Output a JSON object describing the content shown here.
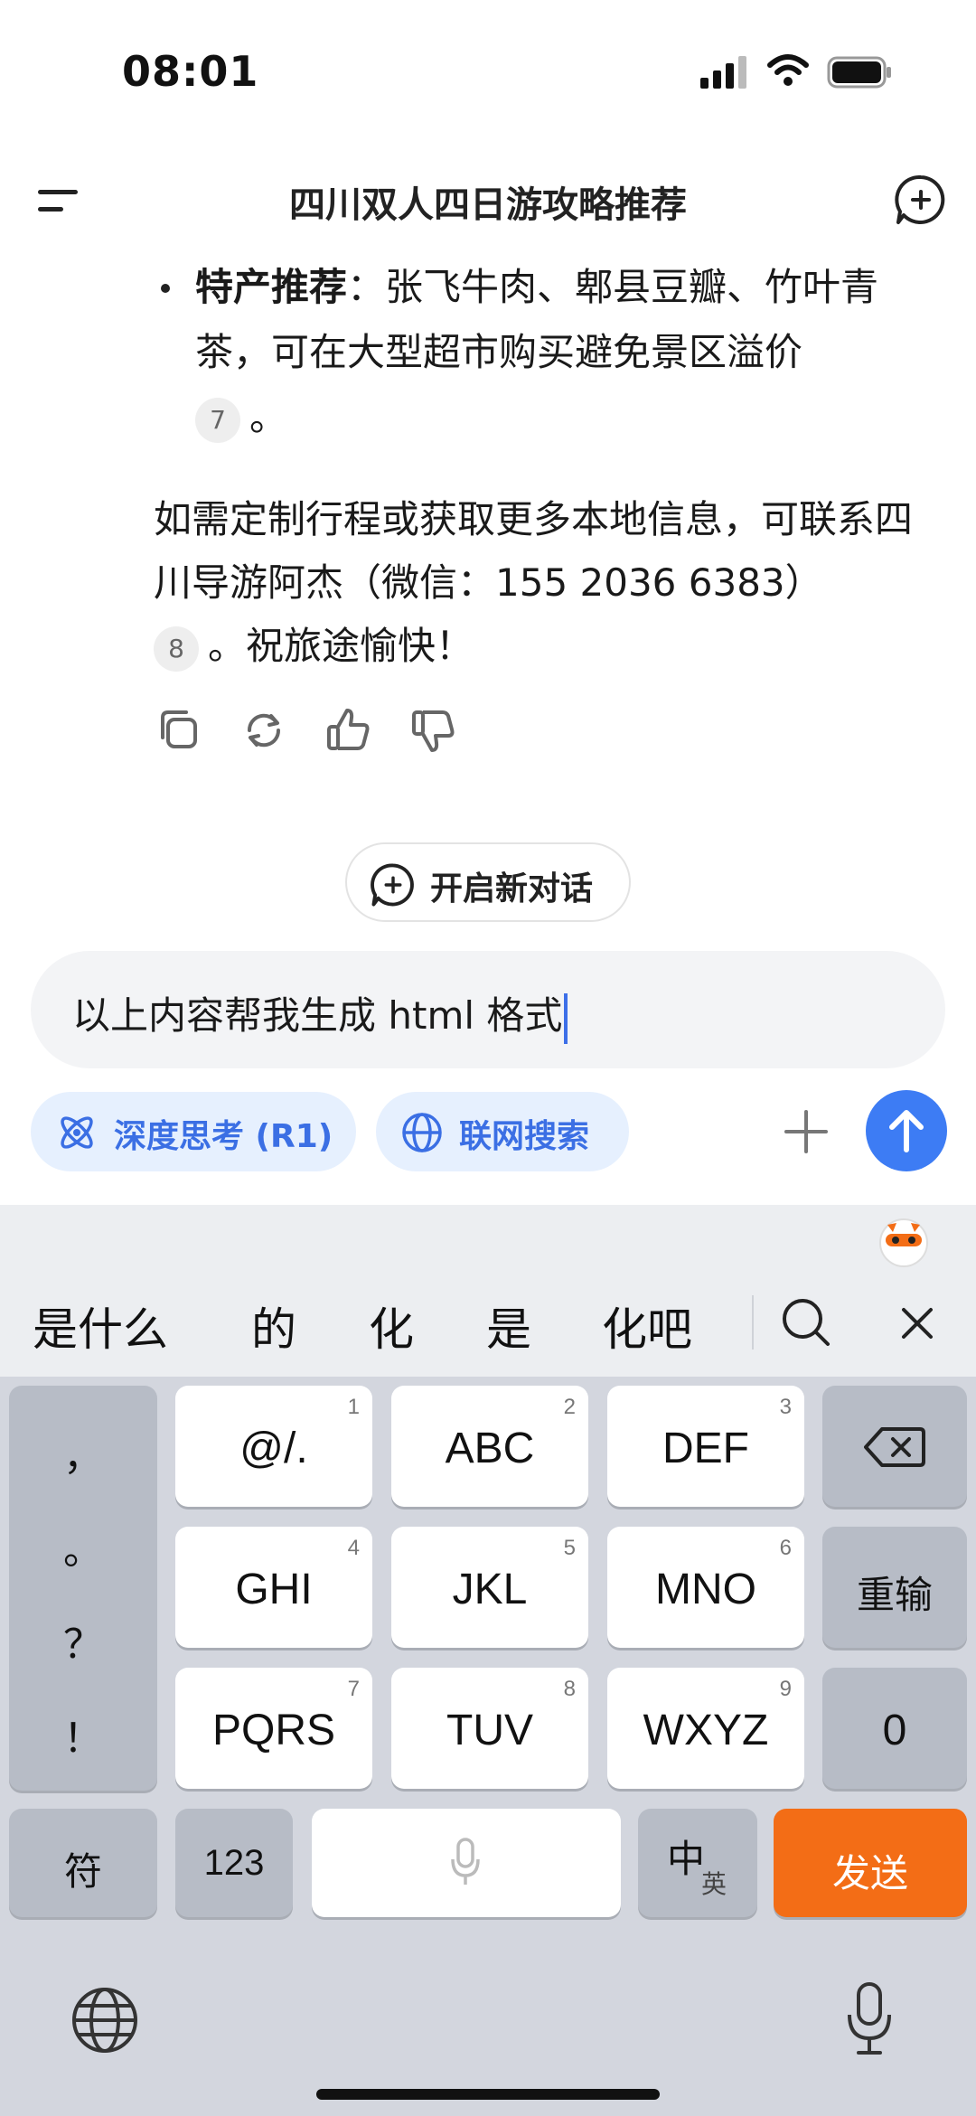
{
  "status_bar": {
    "time": "08:01"
  },
  "header": {
    "title": "四川双人四日游攻略推荐"
  },
  "message": {
    "bullet_label": "特产推荐",
    "bullet_body": "：张飞牛肉、郫县豆瓣、竹叶青茶，可在大型超市购买避免景区溢价",
    "bullet_cite": "7",
    "bullet_end": "。",
    "para_text": "如需定制行程或获取更多本地信息，可联系四川导游阿杰（微信：155 2036 6383）",
    "para_cite": "8",
    "para_end": "。祝旅途愉快！"
  },
  "new_dialog_label": "开启新对话",
  "input": {
    "value": "以上内容帮我生成 html 格式"
  },
  "chips": {
    "deep_think": "深度思考 (R1)",
    "web_search": "联网搜索"
  },
  "keyboard": {
    "candidates": [
      "是什么",
      "的",
      "化",
      "是",
      "化吧"
    ],
    "punct": [
      "，",
      "。",
      "？",
      "！"
    ],
    "rows": [
      [
        {
          "label": "@/.",
          "num": "1"
        },
        {
          "label": "ABC",
          "num": "2"
        },
        {
          "label": "DEF",
          "num": "3"
        }
      ],
      [
        {
          "label": "GHI",
          "num": "4"
        },
        {
          "label": "JKL",
          "num": "5"
        },
        {
          "label": "MNO",
          "num": "6"
        }
      ],
      [
        {
          "label": "PQRS",
          "num": "7"
        },
        {
          "label": "TUV",
          "num": "8"
        },
        {
          "label": "WXYZ",
          "num": "9"
        }
      ]
    ],
    "reenter": "重输",
    "zero": "0",
    "symbols": "符",
    "num_mode": "123",
    "lang_main": "中",
    "lang_sub": "英",
    "send": "发送"
  }
}
